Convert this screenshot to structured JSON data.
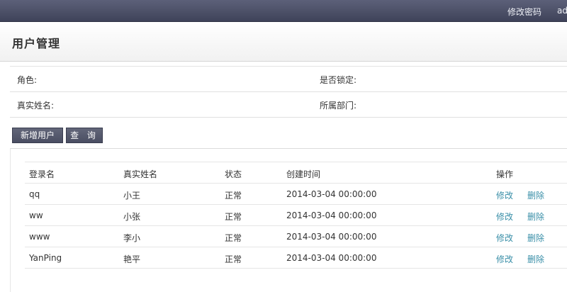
{
  "topbar": {
    "change_password": "修改密码",
    "user": "ad"
  },
  "page": {
    "title": "用户管理"
  },
  "filters": {
    "role_label": "角色:",
    "locked_label": "是否锁定:",
    "realname_label": "真实姓名:",
    "department_label": "所属部门:"
  },
  "buttons": {
    "add_user": "新增用户",
    "query": "查 询"
  },
  "table": {
    "headers": {
      "login": "登录名",
      "realname": "真实姓名",
      "status": "状态",
      "created": "创建时间",
      "action": "操作"
    },
    "rows": [
      {
        "login": "qq",
        "realname": "小王",
        "status": "正常",
        "created": "2014-03-04 00:00:00",
        "edit": "修改",
        "delete": "删除"
      },
      {
        "login": "ww",
        "realname": "小张",
        "status": "正常",
        "created": "2014-03-04 00:00:00",
        "edit": "修改",
        "delete": "删除"
      },
      {
        "login": "www",
        "realname": "李小",
        "status": "正常",
        "created": "2014-03-04 00:00:00",
        "edit": "修改",
        "delete": "删除"
      },
      {
        "login": "YanPing",
        "realname": "艳平",
        "status": "正常",
        "created": "2014-03-04 00:00:00",
        "edit": "修改",
        "delete": "删除"
      }
    ]
  }
}
